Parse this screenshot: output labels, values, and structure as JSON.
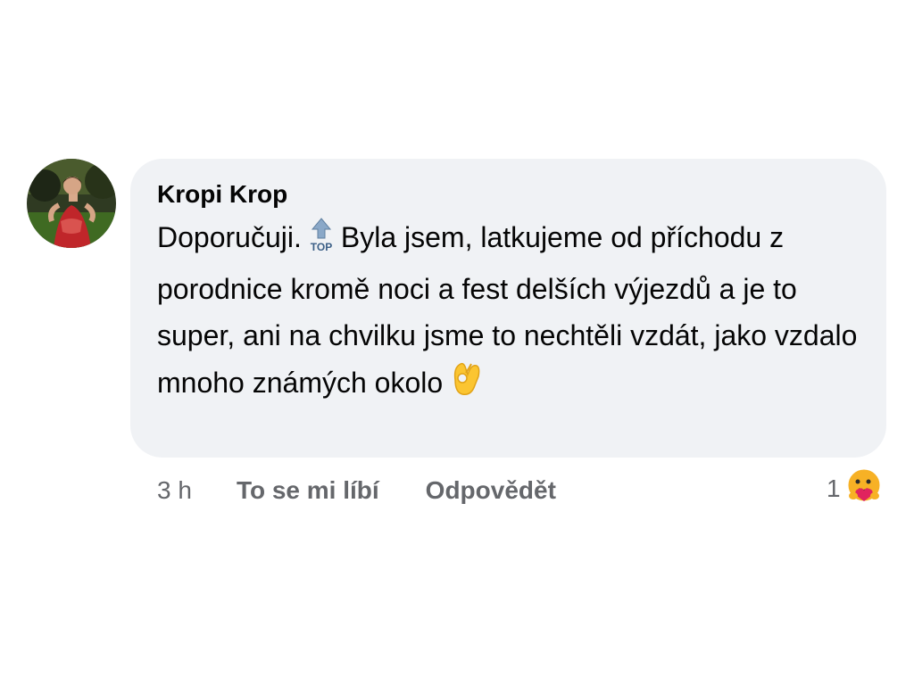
{
  "comment": {
    "author": "Kropi Krop",
    "text_part1": "Doporučuji.",
    "top_emoji": "top-arrow-icon",
    "text_part2": "Byla jsem, latkujeme od příchodu z porodnice kromě noci a fest delších výjezdů a je to super, ani na chvilku jsme to nechtěli vzdát, jako vzdalo mnoho známých okolo",
    "end_emoji": "ok-hand-icon",
    "time": "3 h",
    "like_label": "To se mi líbí",
    "reply_label": "Odpovědět",
    "reaction_count": "1",
    "reaction_icon": "care-reaction-icon"
  },
  "colors": {
    "bubble": "#f0f2f5",
    "secondary_text": "#65676b",
    "primary_text": "#050505"
  }
}
